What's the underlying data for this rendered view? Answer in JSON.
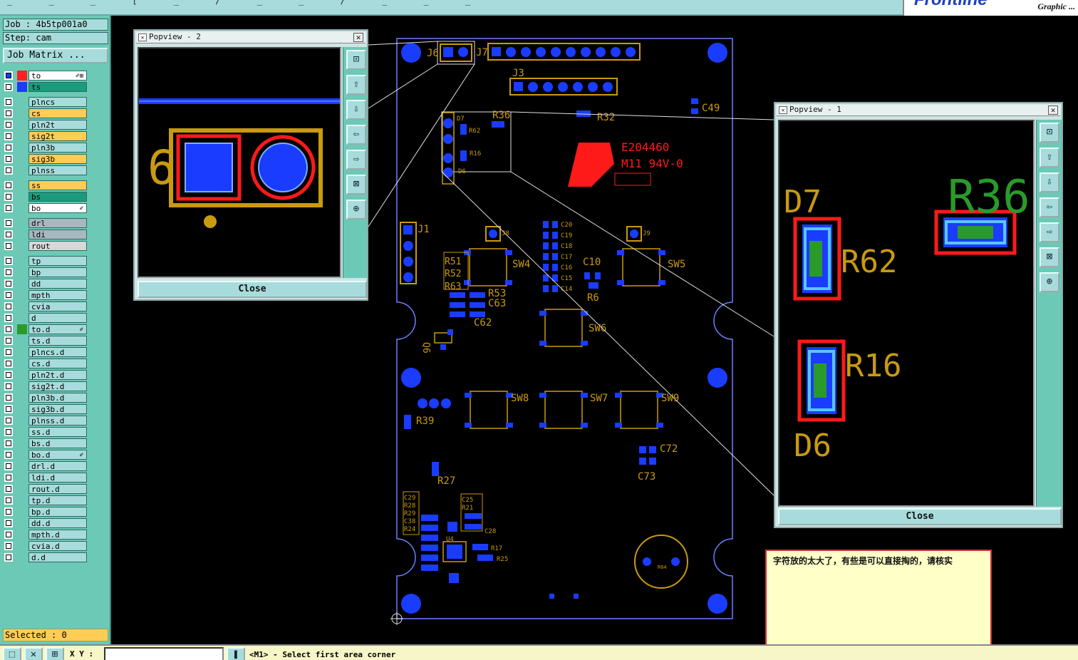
{
  "topbar": {
    "dashes": "_  _  _  [  _  /  _  _  /  _  _  _",
    "brand_logo": "Frontline",
    "brand_tag": "Graphic ..."
  },
  "left_panel": {
    "job": "Job : 4b5tp001a0",
    "step": "Step: cam",
    "job_matrix_button": "Job Matrix ...",
    "layers": [
      {
        "name": "to",
        "swatch": "#ff2020",
        "bg": "#ffffff",
        "mark": "✐⊞",
        "box": "#1a3cff"
      },
      {
        "name": "ts",
        "swatch": "#1a3cff",
        "bg": "#1c9a7c",
        "mark": ""
      },
      {
        "gap": true
      },
      {
        "name": "plncs",
        "swatch": "",
        "bg": "#a8dcdc",
        "mark": ""
      },
      {
        "name": "cs",
        "swatch": "",
        "bg": "#ffcc55",
        "mark": ""
      },
      {
        "name": "pln2t",
        "swatch": "",
        "bg": "#a8dcdc",
        "mark": ""
      },
      {
        "name": "sig2t",
        "swatch": "",
        "bg": "#ffcc55",
        "mark": ""
      },
      {
        "name": "pln3b",
        "swatch": "",
        "bg": "#a8dcdc",
        "mark": ""
      },
      {
        "name": "sig3b",
        "swatch": "",
        "bg": "#ffcc55",
        "mark": ""
      },
      {
        "name": "plnss",
        "swatch": "",
        "bg": "#a8dcdc",
        "mark": ""
      },
      {
        "gap": true
      },
      {
        "name": "ss",
        "swatch": "",
        "bg": "#ffcc55",
        "mark": ""
      },
      {
        "name": "bs",
        "swatch": "",
        "bg": "#1c9a7c",
        "mark": ""
      },
      {
        "name": "bo",
        "swatch": "",
        "bg": "#ffffff",
        "mark": "✐"
      },
      {
        "gap": true
      },
      {
        "name": "drl",
        "swatch": "",
        "bg": "#a8b8c0",
        "mark": ""
      },
      {
        "name": "ldi",
        "swatch": "",
        "bg": "#a8b8c0",
        "mark": ""
      },
      {
        "name": "rout",
        "swatch": "",
        "bg": "#d8d8d8",
        "mark": ""
      },
      {
        "gap": true
      },
      {
        "name": "tp",
        "swatch": "",
        "bg": "#a8dcdc",
        "mark": ""
      },
      {
        "name": "bp",
        "swatch": "",
        "bg": "#a8dcdc",
        "mark": ""
      },
      {
        "name": "dd",
        "swatch": "",
        "bg": "#a8dcdc",
        "mark": ""
      },
      {
        "name": "mpth",
        "swatch": "",
        "bg": "#a8dcdc",
        "mark": ""
      },
      {
        "name": "cvia",
        "swatch": "",
        "bg": "#a8dcdc",
        "mark": ""
      },
      {
        "name": "d",
        "swatch": "",
        "bg": "#a8dcdc",
        "mark": ""
      },
      {
        "name": "to.d",
        "swatch": "#2a9a2a",
        "bg": "#a8dcdc",
        "mark": "✐"
      },
      {
        "name": "ts.d",
        "swatch": "",
        "bg": "#a8dcdc",
        "mark": ""
      },
      {
        "name": "plncs.d",
        "swatch": "",
        "bg": "#a8dcdc",
        "mark": ""
      },
      {
        "name": "cs.d",
        "swatch": "",
        "bg": "#a8dcdc",
        "mark": ""
      },
      {
        "name": "pln2t.d",
        "swatch": "",
        "bg": "#a8dcdc",
        "mark": ""
      },
      {
        "name": "sig2t.d",
        "swatch": "",
        "bg": "#a8dcdc",
        "mark": ""
      },
      {
        "name": "pln3b.d",
        "swatch": "",
        "bg": "#a8dcdc",
        "mark": ""
      },
      {
        "name": "sig3b.d",
        "swatch": "",
        "bg": "#a8dcdc",
        "mark": ""
      },
      {
        "name": "plnss.d",
        "swatch": "",
        "bg": "#a8dcdc",
        "mark": ""
      },
      {
        "name": "ss.d",
        "swatch": "",
        "bg": "#a8dcdc",
        "mark": ""
      },
      {
        "name": "bs.d",
        "swatch": "",
        "bg": "#a8dcdc",
        "mark": ""
      },
      {
        "name": "bo.d",
        "swatch": "",
        "bg": "#a8dcdc",
        "mark": "✐"
      },
      {
        "name": "drl.d",
        "swatch": "",
        "bg": "#a8dcdc",
        "mark": ""
      },
      {
        "name": "ldi.d",
        "swatch": "",
        "bg": "#a8dcdc",
        "mark": ""
      },
      {
        "name": "rout.d",
        "swatch": "",
        "bg": "#a8dcdc",
        "mark": ""
      },
      {
        "name": "tp.d",
        "swatch": "",
        "bg": "#a8dcdc",
        "mark": ""
      },
      {
        "name": "bp.d",
        "swatch": "",
        "bg": "#a8dcdc",
        "mark": ""
      },
      {
        "name": "dd.d",
        "swatch": "",
        "bg": "#a8dcdc",
        "mark": ""
      },
      {
        "name": "mpth.d",
        "swatch": "",
        "bg": "#a8dcdc",
        "mark": ""
      },
      {
        "name": "cvia.d",
        "swatch": "",
        "bg": "#a8dcdc",
        "mark": ""
      },
      {
        "name": "d.d",
        "swatch": "",
        "bg": "#a8dcdc",
        "mark": ""
      }
    ],
    "selected": "Selected : 0"
  },
  "status": {
    "xy_label": "X Y :",
    "xy_value": "",
    "message": "<M1> - Select first area corner",
    "tool_icons": [
      "zoom-area-icon",
      "cross-cursor-icon",
      "grid-icon",
      "pause-icon"
    ]
  },
  "popview2": {
    "title": "Popview - 2",
    "close_label": "Close",
    "ref_label": "6",
    "tools": [
      "zoom-fit-icon",
      "move-up-icon",
      "move-down-icon",
      "move-left-icon",
      "move-right-icon",
      "zoom-in-icon",
      "zoom-out-icon"
    ]
  },
  "popview1": {
    "title": "Popview - 1",
    "close_label": "Close",
    "labels": [
      "D7",
      "R62",
      "R36",
      "R16",
      "D6"
    ],
    "tools": [
      "zoom-fit-icon",
      "move-up-icon",
      "move-down-icon",
      "move-left-icon",
      "move-right-icon",
      "zoom-in-icon",
      "zoom-out-icon"
    ]
  },
  "board": {
    "colors": {
      "outline": "#6a7fff",
      "pad": "#1a3cff",
      "silk": "#c99a10",
      "copper_red": "#ff1a1a",
      "leader": "#e0e0e0"
    },
    "refs": [
      "J6",
      "J7",
      "J3",
      "C49",
      "D7",
      "R62",
      "R36",
      "R16",
      "R32",
      "D6",
      "J1",
      "J8",
      "J9",
      "SW4",
      "SW5",
      "C20",
      "C19",
      "C18",
      "C17",
      "C16",
      "C15",
      "C14",
      "C10",
      "R6",
      "R51",
      "R52",
      "R63",
      "R53",
      "C63",
      "C62",
      "Q6",
      "SW6",
      "SW8",
      "SW7",
      "SW9",
      "R39",
      "C72",
      "C73",
      "R27",
      "C29",
      "R28",
      "R29",
      "C38",
      "R24",
      "C25",
      "R21",
      "C28",
      "U4",
      "R17",
      "R25",
      "R64"
    ],
    "marking_1": "E204460",
    "marking_2": "M11 94V-0"
  },
  "note": {
    "text": "字符放的太大了，有些是可以直接掏的，请核实"
  }
}
